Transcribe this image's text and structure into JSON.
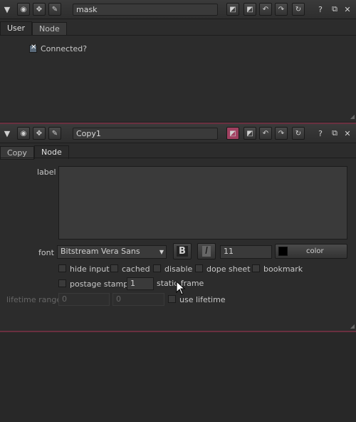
{
  "panel1": {
    "name": "mask",
    "tabs": [
      "User",
      "Node"
    ],
    "connected_label": "Connected?"
  },
  "panel2": {
    "name": "Copy1",
    "tabs": [
      "Copy",
      "Node"
    ],
    "label_label": "label",
    "font_label": "font",
    "font_value": "Bitstream Vera Sans",
    "bold_label": "B",
    "italic_label": "I",
    "font_size": "11",
    "color_label": "color",
    "checkboxes": [
      "hide input",
      "cached",
      "disable",
      "dope sheet",
      "bookmark"
    ],
    "postage_label": "postage stamp",
    "static_frame_value": "1",
    "static_frame_label": "static frame",
    "lifetime_label": "lifetime range",
    "lifetime_start": "0",
    "lifetime_end": "0",
    "use_lifetime_label": "use lifetime"
  },
  "header_icons": {
    "collapse": "▼",
    "help": "?",
    "float": "⧉",
    "close": "✕"
  },
  "colors": {
    "separator": "#6a3040",
    "node_color_swatch_panel2": "#a04060"
  }
}
